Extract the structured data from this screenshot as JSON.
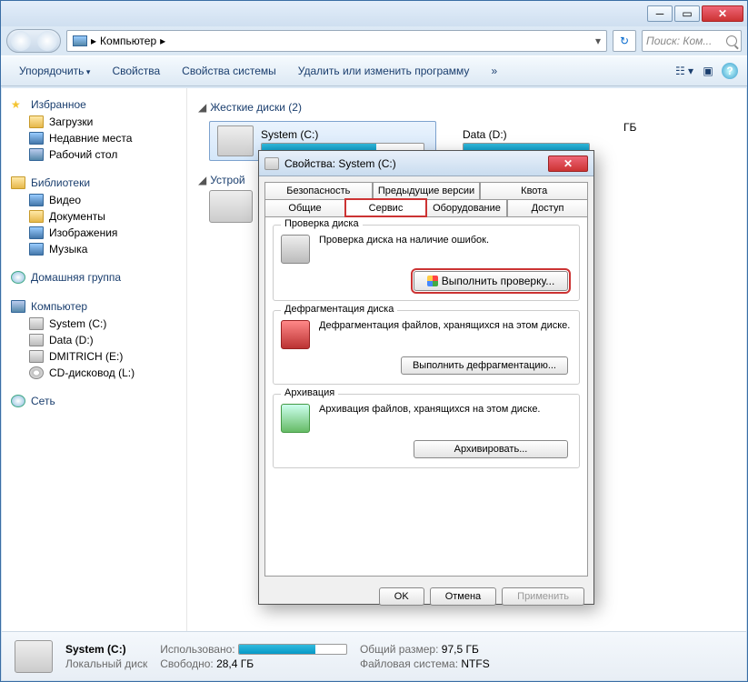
{
  "window": {
    "title_app": "Компьютер"
  },
  "address": {
    "crumb1": "Компьютер",
    "crumb_sep": "▸",
    "search_placeholder": "Поиск: Ком..."
  },
  "toolbar": {
    "organize": "Упорядочить",
    "properties": "Свойства",
    "sysprops": "Свойства системы",
    "uninstall": "Удалить или изменить программу",
    "more": "»"
  },
  "sidebar": {
    "fav": "Избранное",
    "downloads": "Загрузки",
    "recent": "Недавние места",
    "desktop": "Рабочий стол",
    "libs": "Библиотеки",
    "video": "Видео",
    "docs": "Документы",
    "images": "Изображения",
    "music": "Музыка",
    "homegroup": "Домашняя группа",
    "computer": "Компьютер",
    "sysc": "System (C:)",
    "datad": "Data (D:)",
    "dmitrich": "DMITRICH (E:)",
    "cd": "CD-дисковод (L:)",
    "network": "Сеть"
  },
  "main": {
    "hard_drives": "Жесткие диски (2)",
    "devices": "Устрой",
    "drive_c": "System (C:)",
    "drive_d": "Data (D:)",
    "gb_suffix": "ГБ"
  },
  "dialog": {
    "title": "Свойства: System (C:)",
    "tabs": {
      "security": "Безопасность",
      "prev": "Предыдущие версии",
      "quota": "Квота",
      "general": "Общие",
      "tools": "Сервис",
      "hardware": "Оборудование",
      "sharing": "Доступ"
    },
    "check": {
      "legend": "Проверка диска",
      "desc": "Проверка диска на наличие ошибок.",
      "btn": "Выполнить проверку..."
    },
    "defrag": {
      "legend": "Дефрагментация диска",
      "desc": "Дефрагментация файлов, хранящихся на этом диске.",
      "btn": "Выполнить дефрагментацию..."
    },
    "backup": {
      "legend": "Архивация",
      "desc": "Архивация файлов, хранящихся на этом диске.",
      "btn": "Архивировать..."
    },
    "ok": "OK",
    "cancel": "Отмена",
    "apply": "Применить"
  },
  "status": {
    "name": "System (C:)",
    "type_label": "Локальный диск",
    "used_label": "Использовано:",
    "free_label": "Свободно:",
    "free_val": "28,4 ГБ",
    "total_label": "Общий размер:",
    "total_val": "97,5 ГБ",
    "fs_label": "Файловая система:",
    "fs_val": "NTFS"
  }
}
